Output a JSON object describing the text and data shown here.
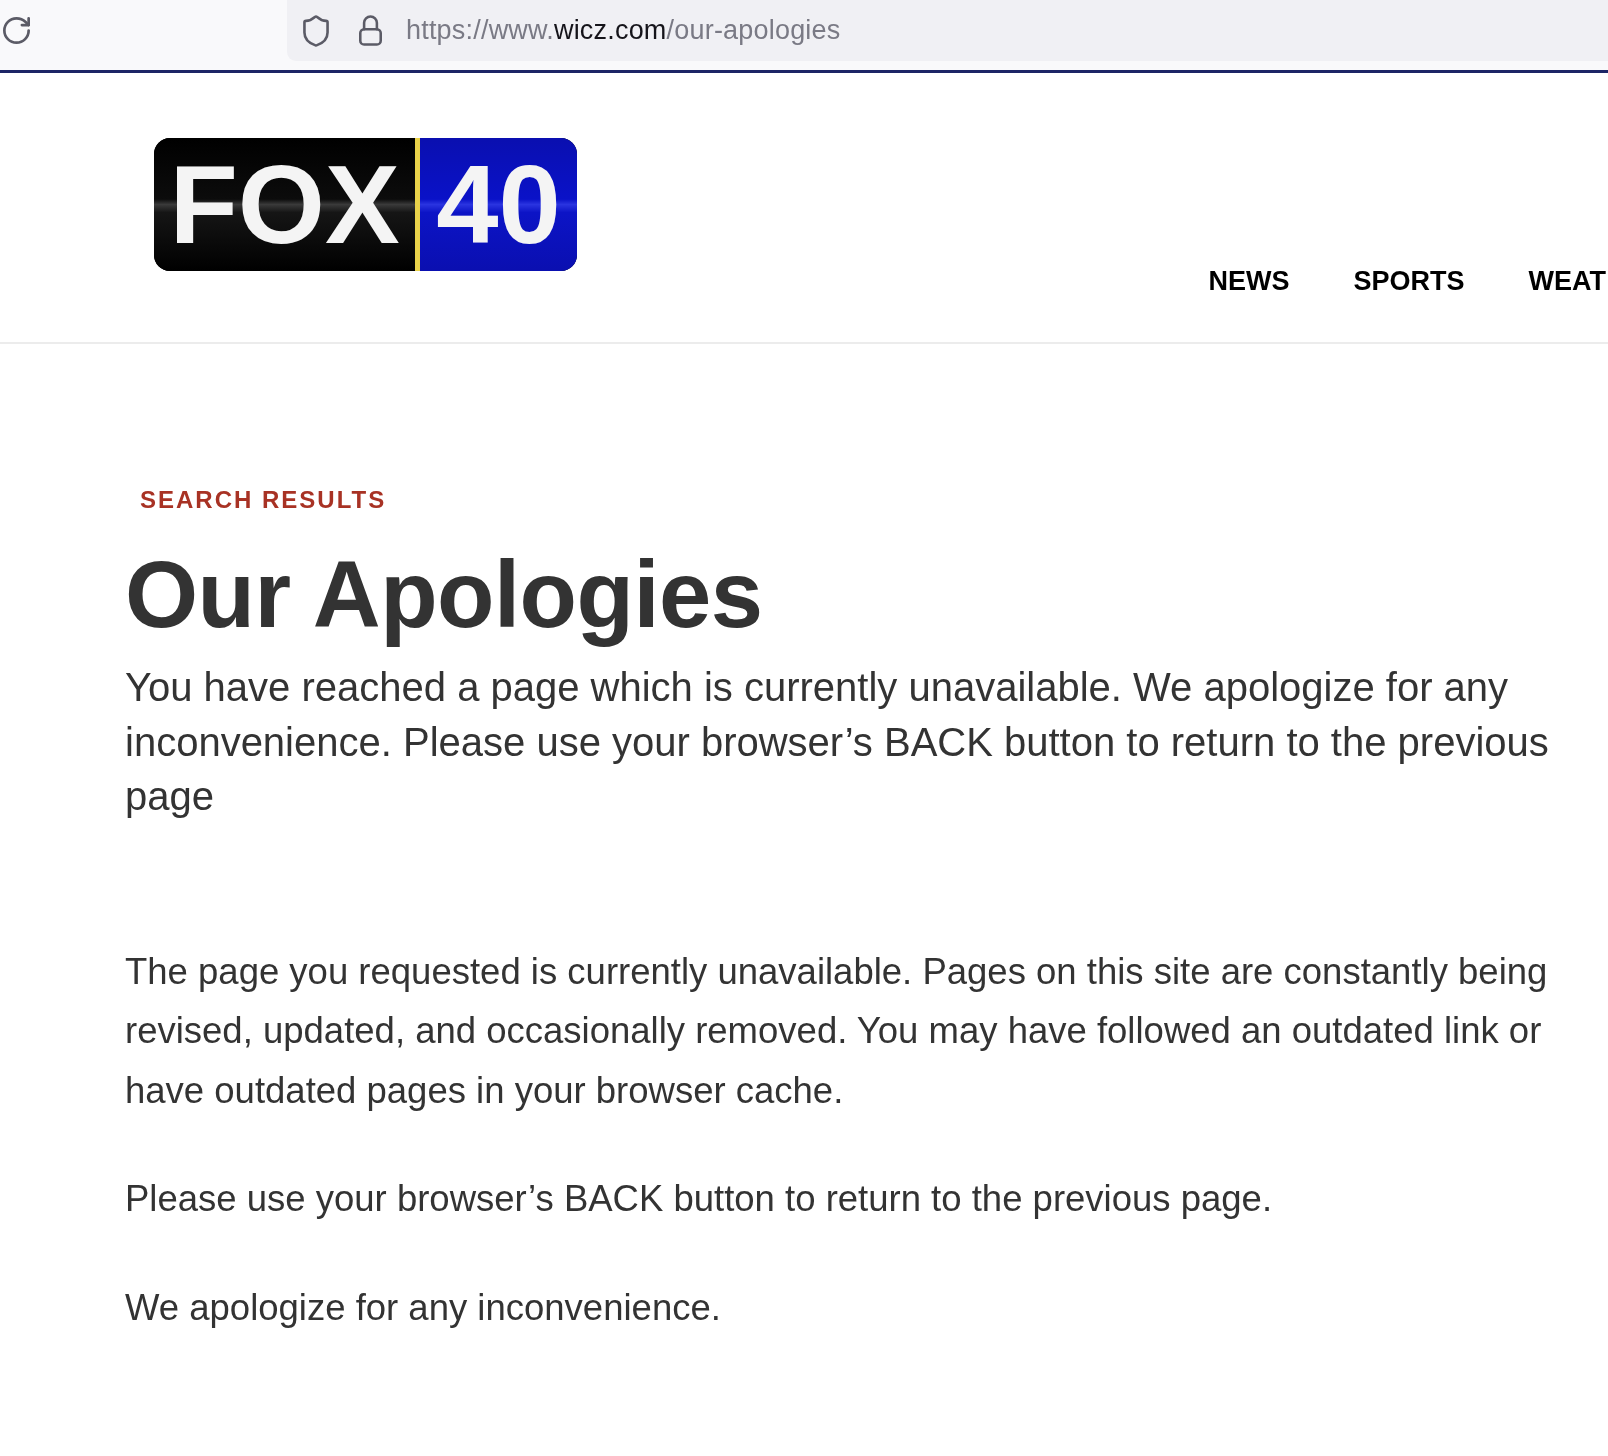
{
  "browser": {
    "url": {
      "prefix": "https://www.",
      "domain": "wicz.com",
      "path": "/our-apologies"
    }
  },
  "header": {
    "logo": {
      "wordmark": "FOX",
      "channel": "40"
    },
    "nav": [
      {
        "label": "NEWS"
      },
      {
        "label": "SPORTS"
      },
      {
        "label": "WEAT"
      }
    ]
  },
  "content": {
    "eyebrow": "SEARCH RESULTS",
    "title": "Our Apologies",
    "lead": "You have reached a page which is currently unavailable. We apologize for any inconvenience. Please use your browser’s BACK button to return to the previous page",
    "paragraphs": [
      "The page you requested is currently unavailable. Pages on this site are constantly being revised, updated, and occasionally removed. You may have followed an outdated link or have outdated pages in your browser cache.",
      "Please use your browser’s BACK button to return to the previous page.",
      "We apologize for any inconvenience."
    ]
  }
}
